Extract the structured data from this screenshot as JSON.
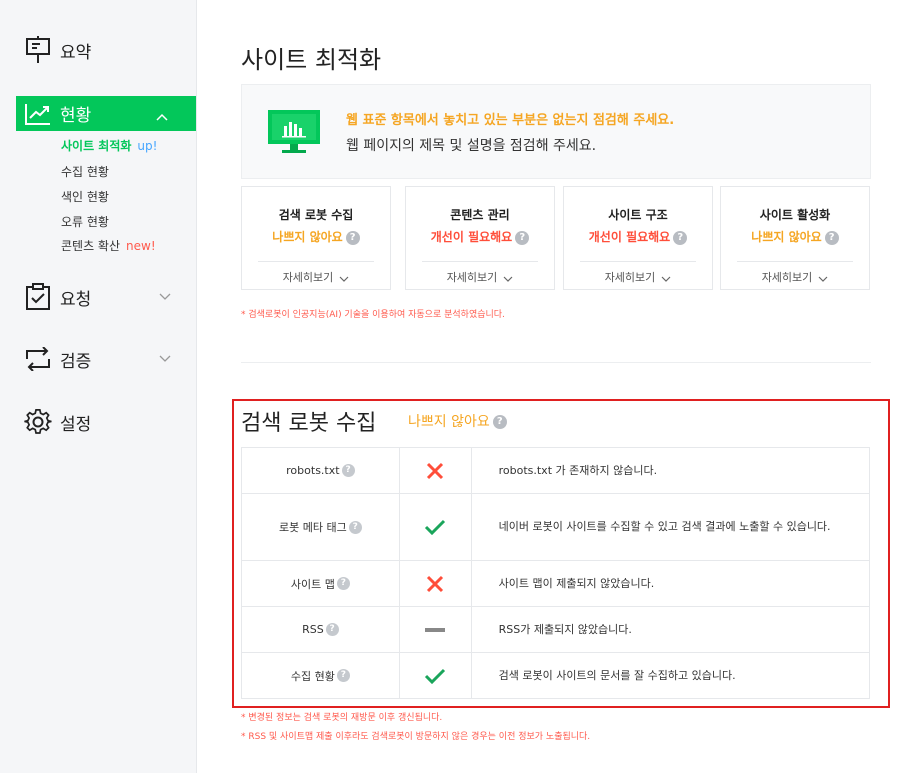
{
  "sidebar": {
    "summary": "요약",
    "status": "현황",
    "sub_items": [
      {
        "label": "사이트 최적화",
        "badge": "up!"
      },
      {
        "label": "수집 현황",
        "badge": ""
      },
      {
        "label": "색인 현황",
        "badge": ""
      },
      {
        "label": "오류 현황",
        "badge": ""
      },
      {
        "label": "콘텐츠 확산",
        "badge": "new!"
      }
    ],
    "request": "요청",
    "verify": "검증",
    "settings": "설정"
  },
  "page": {
    "title": "사이트 최적화"
  },
  "alert": {
    "main": "웹 표준 항목에서 놓치고 있는 부분은 없는지 점검해 주세요.",
    "sub": "웹 페이지의 제목 및 설명을 점검해 주세요."
  },
  "cards": [
    {
      "title": "검색 로봇 수집",
      "status": "나쁘지 않아요",
      "level": "warn",
      "more": "자세히보기"
    },
    {
      "title": "콘텐츠 관리",
      "status": "개선이 필요해요",
      "level": "bad",
      "more": "자세히보기"
    },
    {
      "title": "사이트 구조",
      "status": "개선이 필요해요",
      "level": "bad",
      "more": "자세히보기"
    },
    {
      "title": "사이트 활성화",
      "status": "나쁘지 않아요",
      "level": "warn",
      "more": "자세히보기"
    }
  ],
  "ai_note": "* 검색로봇이 인공지능(AI) 기술을 이용하여 자동으로 분석하였습니다.",
  "section": {
    "title": "검색 로봇 수집",
    "status": "나쁘지 않아요",
    "rows": [
      {
        "name": "robots.txt",
        "result": "x",
        "desc": "robots.txt 가 존재하지 않습니다."
      },
      {
        "name": "로봇 메타 태그",
        "result": "check",
        "desc": "네이버 로봇이 사이트를 수집할 수 있고 검색 결과에 노출할 수 있습니다."
      },
      {
        "name": "사이트 맵",
        "result": "x",
        "desc": "사이트 맵이 제출되지 않았습니다."
      },
      {
        "name": "RSS",
        "result": "dash",
        "desc": "RSS가 제출되지 않았습니다."
      },
      {
        "name": "수집 현황",
        "result": "check",
        "desc": "검색 로봇이 사이트의 문서를 잘 수집하고 있습니다."
      }
    ]
  },
  "notes": [
    "* 변경된 정보는 검색 로봇의 재방문 이후 갱신됩니다.",
    "* RSS 및 사이트맵 제출 이후라도 검색로봇이 방문하지 않은 경우는 이전 정보가 노출됩니다."
  ],
  "colors": {
    "accent": "#03c75a",
    "warn": "#f5a623",
    "bad": "#ff4e3a",
    "frame": "#e02020"
  }
}
